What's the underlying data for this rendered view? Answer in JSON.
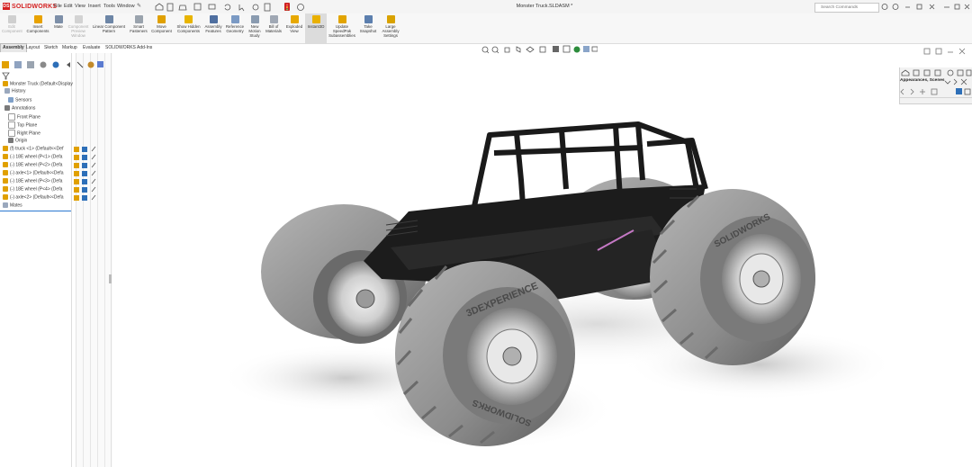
{
  "app": {
    "name": "SOLIDWORKS",
    "document_title": "Monster Truck.SLDASM *"
  },
  "menu": [
    "File",
    "Edit",
    "View",
    "Insert",
    "Tools",
    "Window"
  ],
  "search": {
    "placeholder": "Search Commands"
  },
  "commands": [
    {
      "label": "Edit Component",
      "disabled": true
    },
    {
      "label": "Insert Components",
      "disabled": false
    },
    {
      "label": "Mate",
      "disabled": false
    },
    {
      "label": "Component Preview Window",
      "disabled": true
    },
    {
      "label": "Linear Component Pattern",
      "disabled": false
    },
    {
      "label": "Smart Fasteners",
      "disabled": false
    },
    {
      "label": "Move Component",
      "disabled": false
    },
    {
      "label": "Show Hidden Components",
      "disabled": false
    },
    {
      "label": "Assembly Features",
      "disabled": false
    },
    {
      "label": "Reference Geometry",
      "disabled": false
    },
    {
      "label": "New Motion Study",
      "disabled": false
    },
    {
      "label": "Bill of Materials",
      "disabled": false
    },
    {
      "label": "Exploded View",
      "disabled": false
    },
    {
      "label": "Instant3D",
      "disabled": false
    },
    {
      "label": "Update SpeedPak Subassemblies",
      "disabled": false
    },
    {
      "label": "Take Snapshot",
      "disabled": false
    },
    {
      "label": "Large Assembly Settings",
      "disabled": false
    }
  ],
  "tabs": [
    "Assembly",
    "Layout",
    "Sketch",
    "Markup",
    "Evaluate",
    "SOLIDWORKS Add-Ins"
  ],
  "active_tab": "Assembly",
  "tree": {
    "root": "Monster Truck (Default<Display",
    "items": [
      "History",
      "Sensors",
      "Annotations",
      "Front Plane",
      "Top Plane",
      "Right Plane",
      "Origin",
      "(f) truck <1> (Default<<Def",
      "(-) 18E wheel (P<1> (Defa",
      "(-) 18E wheel (P<2> (Defa",
      "(-) axle<1> (Default<<Defa",
      "(-) 18E wheel (P<3> (Defa",
      "(-) 18E wheel (P<4> (Defa",
      "(-) axle<2> (Default<<Defa",
      "Mates"
    ]
  },
  "task_pane": {
    "title": "Appearances, Scenes"
  },
  "tire_text": [
    "SOLIDWORKS",
    "3DEXPERIENCE"
  ],
  "colors": {
    "brand": "#d42020",
    "accent": "#1e7ad8",
    "tire": "#8f8f8f",
    "chassis": "#1a1a1a"
  }
}
